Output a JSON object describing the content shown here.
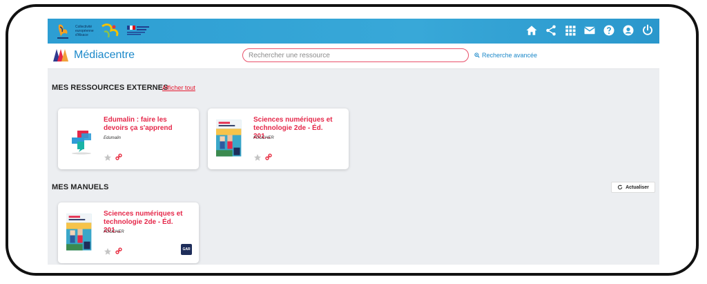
{
  "header": {
    "logo_caption": "Collectivité européenne d'Alsace",
    "icons": [
      "home-icon",
      "share-icon",
      "apps-grid-icon",
      "mail-icon",
      "help-icon",
      "account-icon",
      "logout-icon"
    ]
  },
  "subbar": {
    "title": "Médiacentre",
    "search_placeholder": "Rechercher une ressource",
    "advanced_search": "Recherche avancée"
  },
  "external_resources": {
    "title": "MES RESSOURCES EXTERNES",
    "show_all": "Afficher tout",
    "cards": [
      {
        "title": "Edumalin : faire les devoirs ça s'apprend",
        "publisher": "Edumalin"
      },
      {
        "title": "Sciences numériques et technologie 2de - Éd. 201...",
        "publisher": "FOUCHER"
      }
    ]
  },
  "manuals": {
    "title": "MES MANUELS",
    "refresh": "Actualiser",
    "cards": [
      {
        "title": "Sciences numériques et technologie 2de - Éd. 201...",
        "publisher": "FOUCHER",
        "badge": "GAR"
      }
    ]
  },
  "colors": {
    "topbar": "#2d9ed3",
    "accent_red": "#e5284a",
    "brand_blue": "#1b88c9",
    "content_bg": "#eceef1"
  }
}
